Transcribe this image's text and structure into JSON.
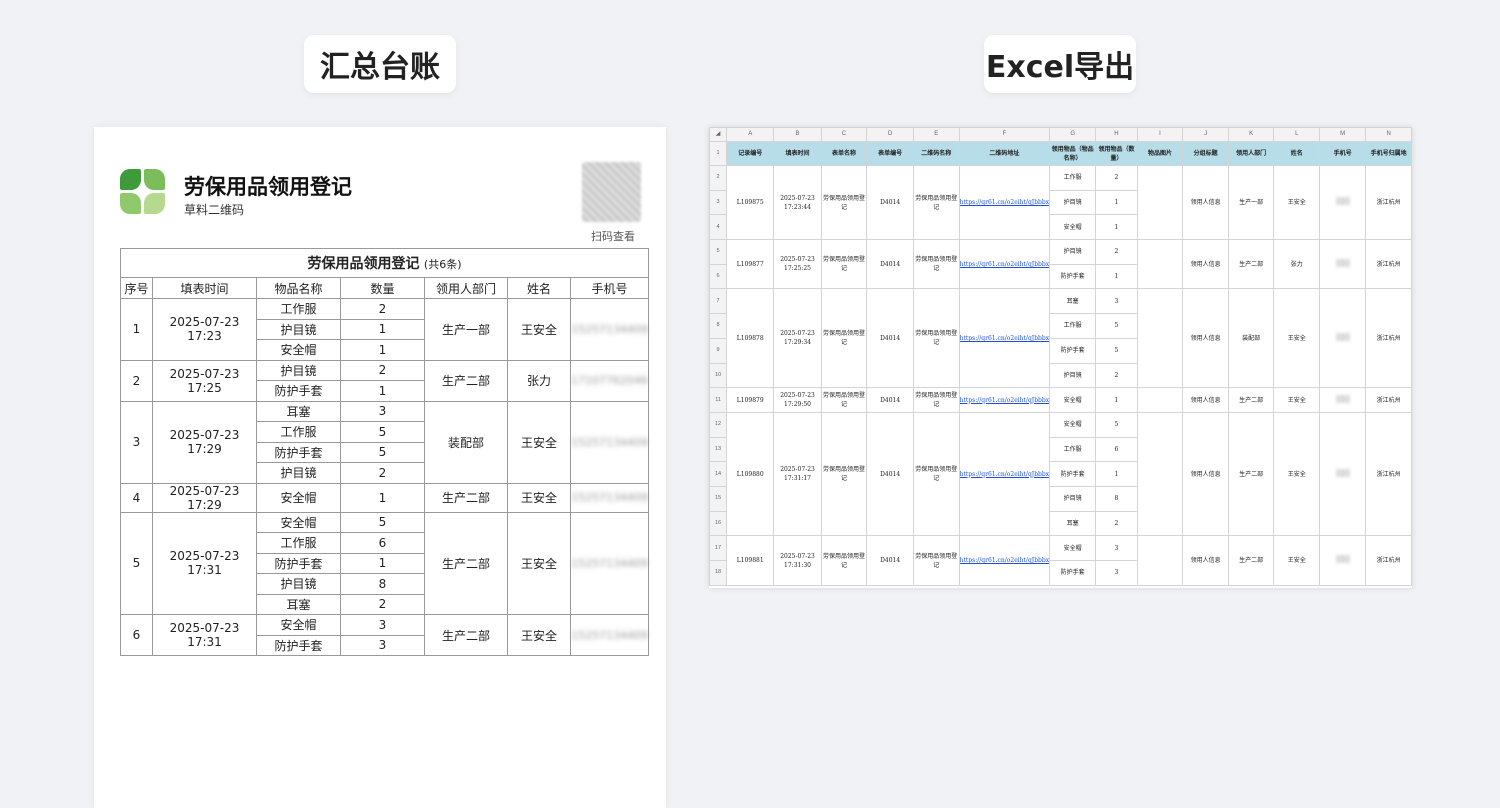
{
  "labels": {
    "left": "汇总台账",
    "right": "Excel导出"
  },
  "doc": {
    "title": "劳保用品领用登记",
    "subtitle": "草料二维码",
    "qr_label": "扫码查看",
    "table_title": "劳保用品领用登记",
    "table_count": "(共6条)",
    "columns": [
      "序号",
      "填表时间",
      "物品名称",
      "数量",
      "领用人部门",
      "姓名",
      "手机号"
    ],
    "records": [
      {
        "no": "1",
        "time": "2025-07-23 17:23",
        "dept": "生产一部",
        "name": "王安全",
        "phone": "15257134409",
        "items": [
          {
            "n": "工作服",
            "q": "2"
          },
          {
            "n": "护目镜",
            "q": "1"
          },
          {
            "n": "安全帽",
            "q": "1"
          }
        ]
      },
      {
        "no": "2",
        "time": "2025-07-23 17:25",
        "dept": "生产二部",
        "name": "张力",
        "phone": "17107762046",
        "items": [
          {
            "n": "护目镜",
            "q": "2"
          },
          {
            "n": "防护手套",
            "q": "1"
          }
        ]
      },
      {
        "no": "3",
        "time": "2025-07-23 17:29",
        "dept": "装配部",
        "name": "王安全",
        "phone": "15257134409",
        "items": [
          {
            "n": "耳塞",
            "q": "3"
          },
          {
            "n": "工作服",
            "q": "5"
          },
          {
            "n": "防护手套",
            "q": "5"
          },
          {
            "n": "护目镜",
            "q": "2"
          }
        ]
      },
      {
        "no": "4",
        "time": "2025-07-23 17:29",
        "dept": "生产二部",
        "name": "王安全",
        "phone": "15257134409",
        "items": [
          {
            "n": "安全帽",
            "q": "1"
          }
        ]
      },
      {
        "no": "5",
        "time": "2025-07-23 17:31",
        "dept": "生产二部",
        "name": "王安全",
        "phone": "15257134409",
        "items": [
          {
            "n": "安全帽",
            "q": "5"
          },
          {
            "n": "工作服",
            "q": "6"
          },
          {
            "n": "防护手套",
            "q": "1"
          },
          {
            "n": "护目镜",
            "q": "8"
          },
          {
            "n": "耳塞",
            "q": "2"
          }
        ]
      },
      {
        "no": "6",
        "time": "2025-07-23 17:31",
        "dept": "生产二部",
        "name": "王安全",
        "phone": "15257134409",
        "items": [
          {
            "n": "安全帽",
            "q": "3"
          },
          {
            "n": "防护手套",
            "q": "3"
          }
        ]
      }
    ]
  },
  "excel": {
    "col_letters": [
      "A",
      "B",
      "C",
      "D",
      "E",
      "F",
      "G",
      "H",
      "I",
      "J",
      "K",
      "L",
      "M",
      "N"
    ],
    "headers": [
      "记录编号",
      "填表时间",
      "表单名称",
      "表单编号",
      "二维码名称",
      "二维码地址",
      "领用物品（物品名称）",
      "领用物品（数量）",
      "物品图片",
      "分组标题",
      "领用人部门",
      "姓名",
      "手机号",
      "手机号归属地"
    ],
    "form_name": "劳保用品领用登记",
    "form_no": "D4014",
    "qr_name": "劳保用品领用登记",
    "qr_url": "https://qr61.cn/o2eiht/qJbbbx",
    "group_title": "领用人信息",
    "phone_region": "浙江杭州",
    "records": [
      {
        "id": "L109875",
        "time": "2025-07-23 17:23:44",
        "dept": "生产一部",
        "name": "王安全",
        "start": 2,
        "items": [
          {
            "n": "工作服",
            "q": "2"
          },
          {
            "n": "护目镜",
            "q": "1"
          },
          {
            "n": "安全帽",
            "q": "1"
          }
        ]
      },
      {
        "id": "L109877",
        "time": "2025-07-23 17:25:25",
        "dept": "生产二部",
        "name": "张力",
        "start": 5,
        "items": [
          {
            "n": "护目镜",
            "q": "2"
          },
          {
            "n": "防护手套",
            "q": "1"
          }
        ]
      },
      {
        "id": "L109878",
        "time": "2025-07-23 17:29:34",
        "dept": "装配部",
        "name": "王安全",
        "start": 7,
        "items": [
          {
            "n": "耳塞",
            "q": "3"
          },
          {
            "n": "工作服",
            "q": "5"
          },
          {
            "n": "防护手套",
            "q": "5"
          },
          {
            "n": "护目镜",
            "q": "2"
          }
        ]
      },
      {
        "id": "L109879",
        "time": "2025-07-23 17:29:50",
        "dept": "生产二部",
        "name": "王安全",
        "start": 11,
        "items": [
          {
            "n": "安全帽",
            "q": "1"
          }
        ]
      },
      {
        "id": "L109880",
        "time": "2025-07-23 17:31:17",
        "dept": "生产二部",
        "name": "王安全",
        "start": 12,
        "items": [
          {
            "n": "安全帽",
            "q": "5"
          },
          {
            "n": "工作服",
            "q": "6"
          },
          {
            "n": "防护手套",
            "q": "1"
          },
          {
            "n": "护目镜",
            "q": "8"
          },
          {
            "n": "耳塞",
            "q": "2"
          }
        ]
      },
      {
        "id": "L109881",
        "time": "2025-07-23 17:31:30",
        "dept": "生产二部",
        "name": "王安全",
        "start": 17,
        "items": [
          {
            "n": "安全帽",
            "q": "3"
          },
          {
            "n": "防护手套",
            "q": "3"
          }
        ]
      }
    ]
  }
}
